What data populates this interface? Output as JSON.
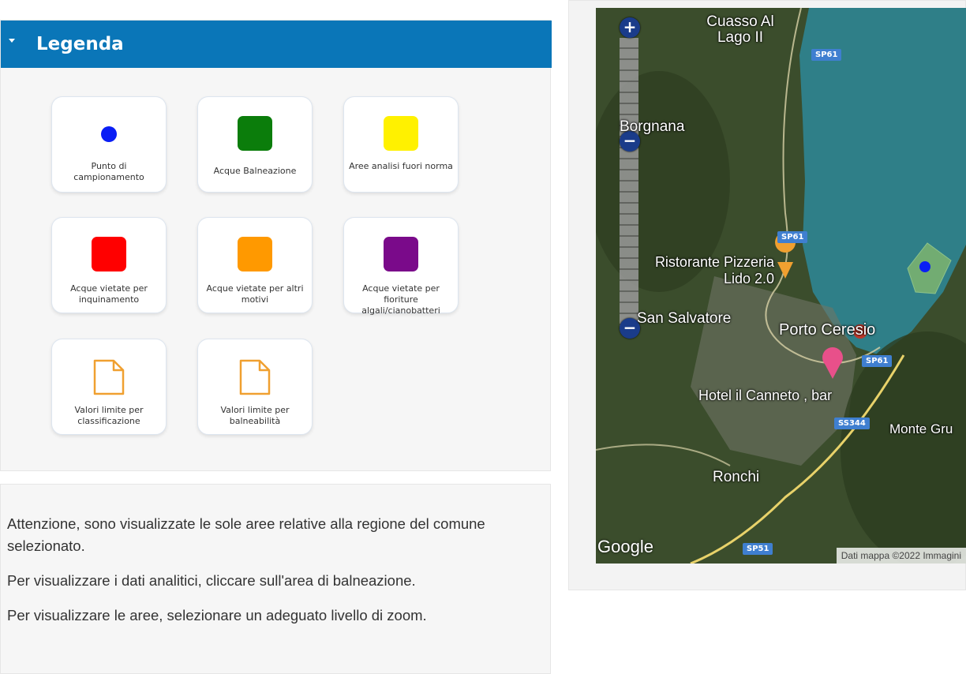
{
  "legend": {
    "title": "Legenda",
    "items": [
      {
        "label": "Punto di campionamento",
        "symbol": "dot",
        "color": "#0a1ef5"
      },
      {
        "label": "Acque Balneazione",
        "symbol": "square",
        "color": "#0b7d0b"
      },
      {
        "label": "Aree analisi fuori norma",
        "symbol": "square",
        "color": "#fff100"
      },
      {
        "label": "Acque vietate per inquinamento",
        "symbol": "square",
        "color": "#ff0000"
      },
      {
        "label": "Acque vietate per altri motivi",
        "symbol": "square",
        "color": "#ff9900"
      },
      {
        "label": "Acque vietate per fioriture algali/cianobatteri",
        "symbol": "square",
        "color": "#7a0a8a"
      },
      {
        "label": "Valori limite per classificazione",
        "symbol": "document-icon",
        "color": "#f0a030"
      },
      {
        "label": "Valori limite per balneabilità",
        "symbol": "document-icon",
        "color": "#f0a030"
      }
    ]
  },
  "info": {
    "line1": "Attenzione, sono visualizzate le sole aree relative alla regione del comune selezionato.",
    "line2": "Per visualizzare i dati analitici, cliccare sull'area di balneazione.",
    "line3": "Per visualizzare le aree, selezionare un adeguato livello di zoom."
  },
  "map": {
    "zoom_in": "+",
    "zoom_out": "−",
    "places": {
      "cuasso": "Cuasso Al Lago II",
      "borgnana": "Borgnana",
      "ristorante": "Ristorante Pizzeria Lido 2.0",
      "san_salvatore": "San Salvatore",
      "porto_ceresio": "Porto Ceresio",
      "hotel": "Hotel il Canneto , bar",
      "monte": "Monte Gru",
      "ronchi": "Ronchi"
    },
    "roads": {
      "sp61_top": "SP61",
      "sp61_mid": "SP61",
      "sp61_low": "SP61",
      "ss344": "SS344",
      "sp51": "SP51"
    },
    "google": "Google",
    "attribution": "Dati mappa ©2022 Immagini",
    "colors": {
      "water": "#2f7f88",
      "land": "#3b4d2c",
      "area": "#8fbf6a",
      "point": "#0a1ef5"
    }
  }
}
